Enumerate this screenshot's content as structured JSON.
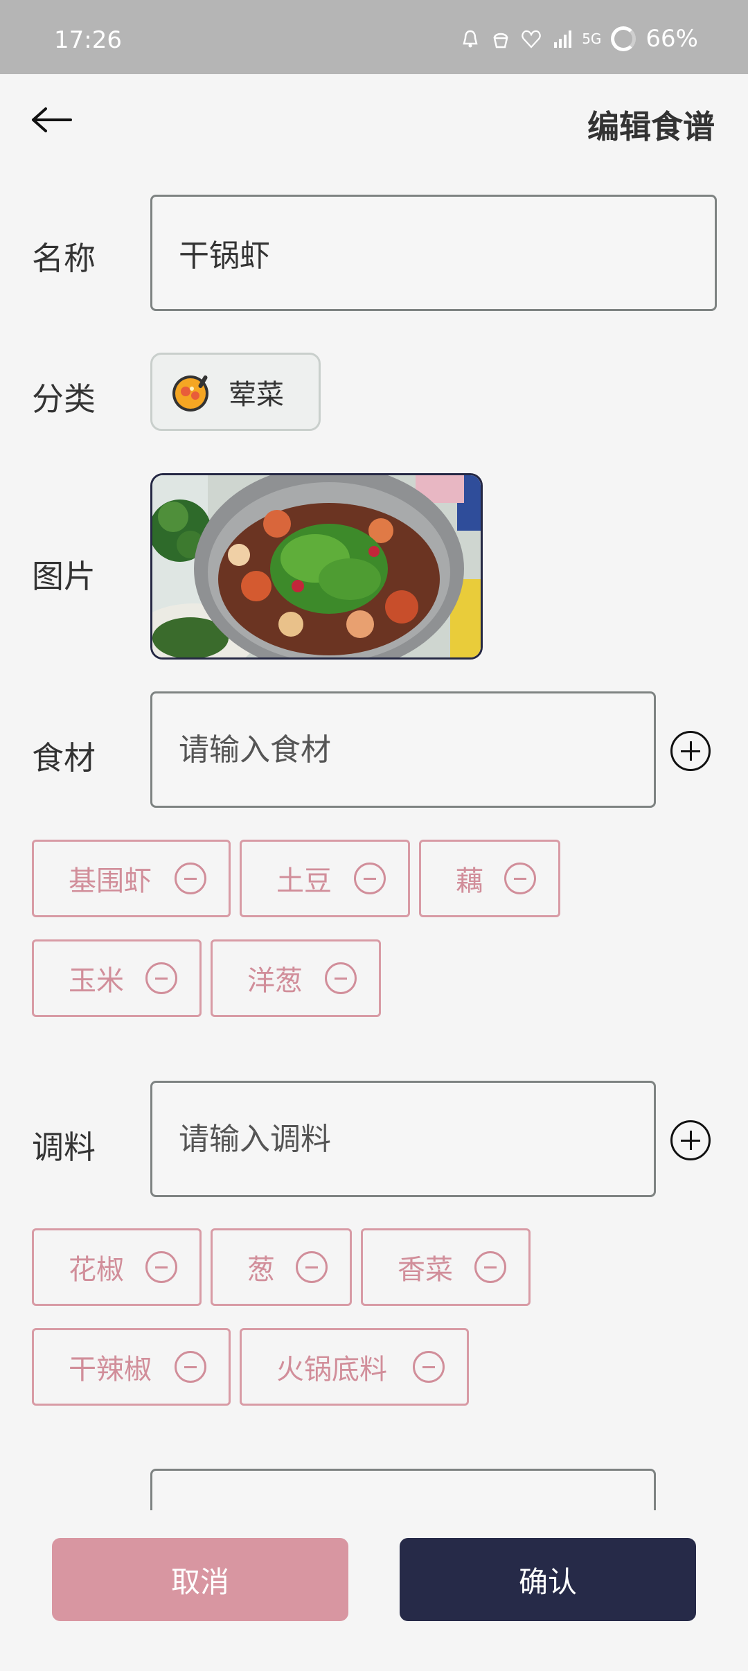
{
  "status_bar": {
    "time": "17:26",
    "network": "5G",
    "battery": "66%"
  },
  "header": {
    "title": "编辑食谱"
  },
  "form": {
    "name": {
      "label": "名称",
      "value": "干锅虾"
    },
    "category": {
      "label": "分类",
      "value": "荤菜"
    },
    "image": {
      "label": "图片"
    },
    "ingredients": {
      "label": "食材",
      "placeholder": "请输入食材",
      "tags": [
        "基围虾",
        "土豆",
        "藕",
        "玉米",
        "洋葱"
      ]
    },
    "seasonings": {
      "label": "调料",
      "placeholder": "请输入调料",
      "tags": [
        "花椒",
        "葱",
        "香菜",
        "干辣椒",
        "火锅底料"
      ]
    }
  },
  "actions": {
    "cancel": "取消",
    "confirm": "确认"
  },
  "colors": {
    "accent_pink": "#d896a1",
    "dark_navy": "#262a48",
    "tag_text": "#d18e9a"
  }
}
